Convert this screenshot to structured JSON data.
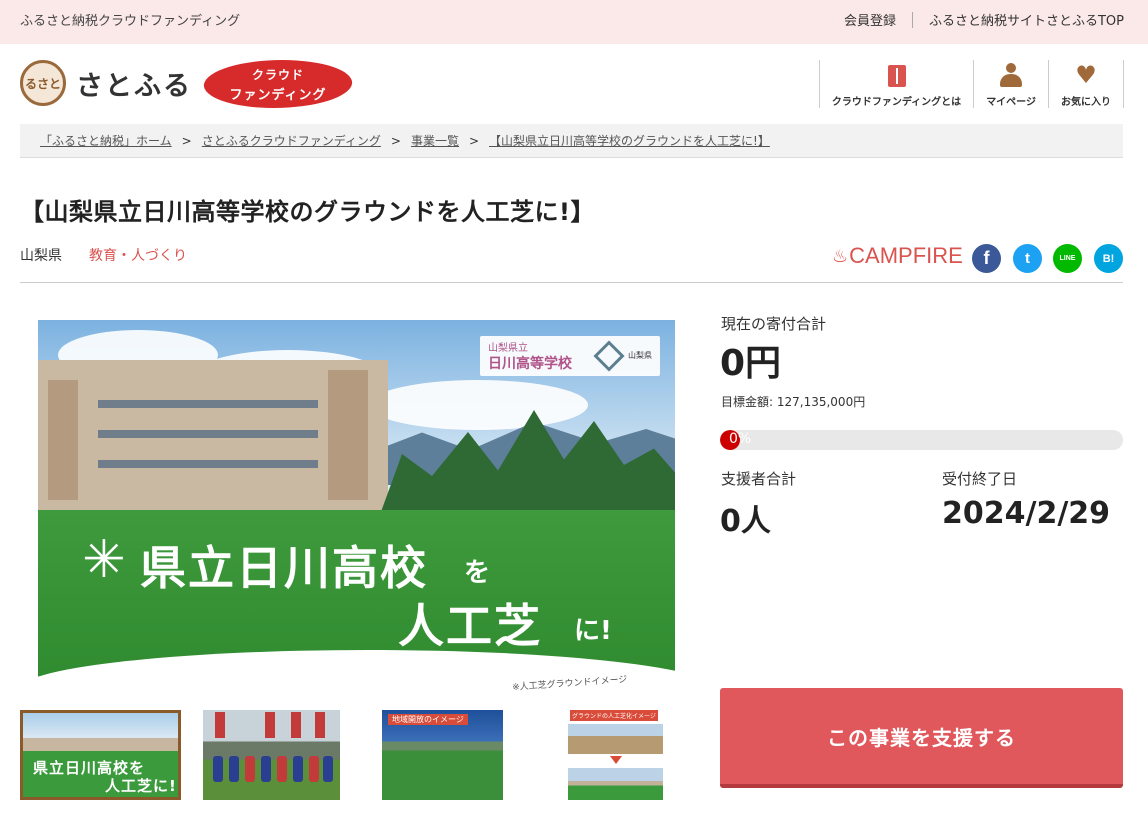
{
  "topbar": {
    "site_name": "ふるさと納税クラウドファンディング",
    "links": [
      "会員登録",
      "ふるさと納税サイトさとふるTOP"
    ]
  },
  "header": {
    "logo_text": "さとふる",
    "logo_mark_text": "るさと",
    "badge_line1": "クラウド",
    "badge_line2": "ファンディング",
    "nav": [
      {
        "label": "クラウドファンディングとは",
        "icon": "book-icon"
      },
      {
        "label": "マイページ",
        "icon": "user-icon"
      },
      {
        "label": "お気に入り",
        "icon": "heart-icon"
      }
    ]
  },
  "breadcrumb": [
    "「ふるさと納税」ホーム",
    "さとふるクラウドファンディング",
    "事業一覧",
    "【山梨県立日川高等学校のグラウンドを人工芝に!】"
  ],
  "project": {
    "title": "【山梨県立日川高等学校のグラウンドを人工芝に!】",
    "prefecture": "山梨県",
    "category": "教育・人づくり",
    "partner": "CAMPFIRE",
    "share": {
      "facebook": "f",
      "twitter": "t",
      "line": "LINE",
      "hatena": "B!"
    }
  },
  "main_image": {
    "school_small": "山梨県立",
    "school_name": "日川高等学校",
    "pref_mark": "山梨県",
    "headline1": "県立日川高校",
    "headline_wo": "を",
    "headline2": "人工芝",
    "headline_ni": "に!",
    "caption": "※人工芝グラウンドイメージ"
  },
  "thumbnails": [
    {
      "name": "thumb-main",
      "line1": "県立日川高校を",
      "line2": "人工芝に!",
      "selected": true
    },
    {
      "name": "thumb-rugby",
      "selected": false
    },
    {
      "name": "thumb-ground",
      "label": "地域開放のイメージ",
      "selected": false
    },
    {
      "name": "thumb-compare",
      "label": "グラウンドの人工芝化イメージ",
      "selected": false
    }
  ],
  "funding": {
    "current_label": "現在の寄付合計",
    "current_value": "0円",
    "goal_text": "目標金額: 127,135,000円",
    "progress_percent": 0,
    "progress_text": "0%",
    "supporters_label": "支援者合計",
    "supporters_value": "0人",
    "deadline_label": "受付終了日",
    "deadline_value": "2024/2/29",
    "support_button": "この事業を支援する"
  },
  "colors": {
    "accent_red": "#d9534f",
    "button": "#e0585c",
    "topbar_bg": "#fbe8e8",
    "brown": "#a0693a"
  }
}
